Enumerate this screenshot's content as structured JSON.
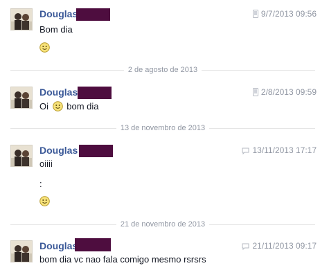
{
  "messages": [
    {
      "sender": "Douglas",
      "time": "9/7/2013 09:56",
      "lines": [
        "Bom dia"
      ],
      "icon": "mobile-icon"
    },
    {
      "sender": "Douglas",
      "time": "2/8/2013 09:59",
      "text_before_smiley": "Oi",
      "text_after_smiley": "bom dia",
      "icon": "mobile-icon"
    },
    {
      "sender": "Douglas",
      "time": "13/11/2013 17:17",
      "lines": [
        "oiiii",
        ":"
      ],
      "icon": "chat-icon"
    },
    {
      "sender": "Douglas",
      "time": "21/11/2013 09:17",
      "lines": [
        "bom dia vc nao fala comigo mesmo rsrsrs"
      ],
      "icon": "chat-icon"
    }
  ],
  "dividers": [
    "2 de agosto de 2013",
    "13 de novembro de 2013",
    "21 de novembro de 2013"
  ],
  "colors": {
    "sender_name": "#3b5998",
    "redaction": "#4e0d3f",
    "meta_text": "#9197a3",
    "divider_line": "#e5e5e5"
  }
}
